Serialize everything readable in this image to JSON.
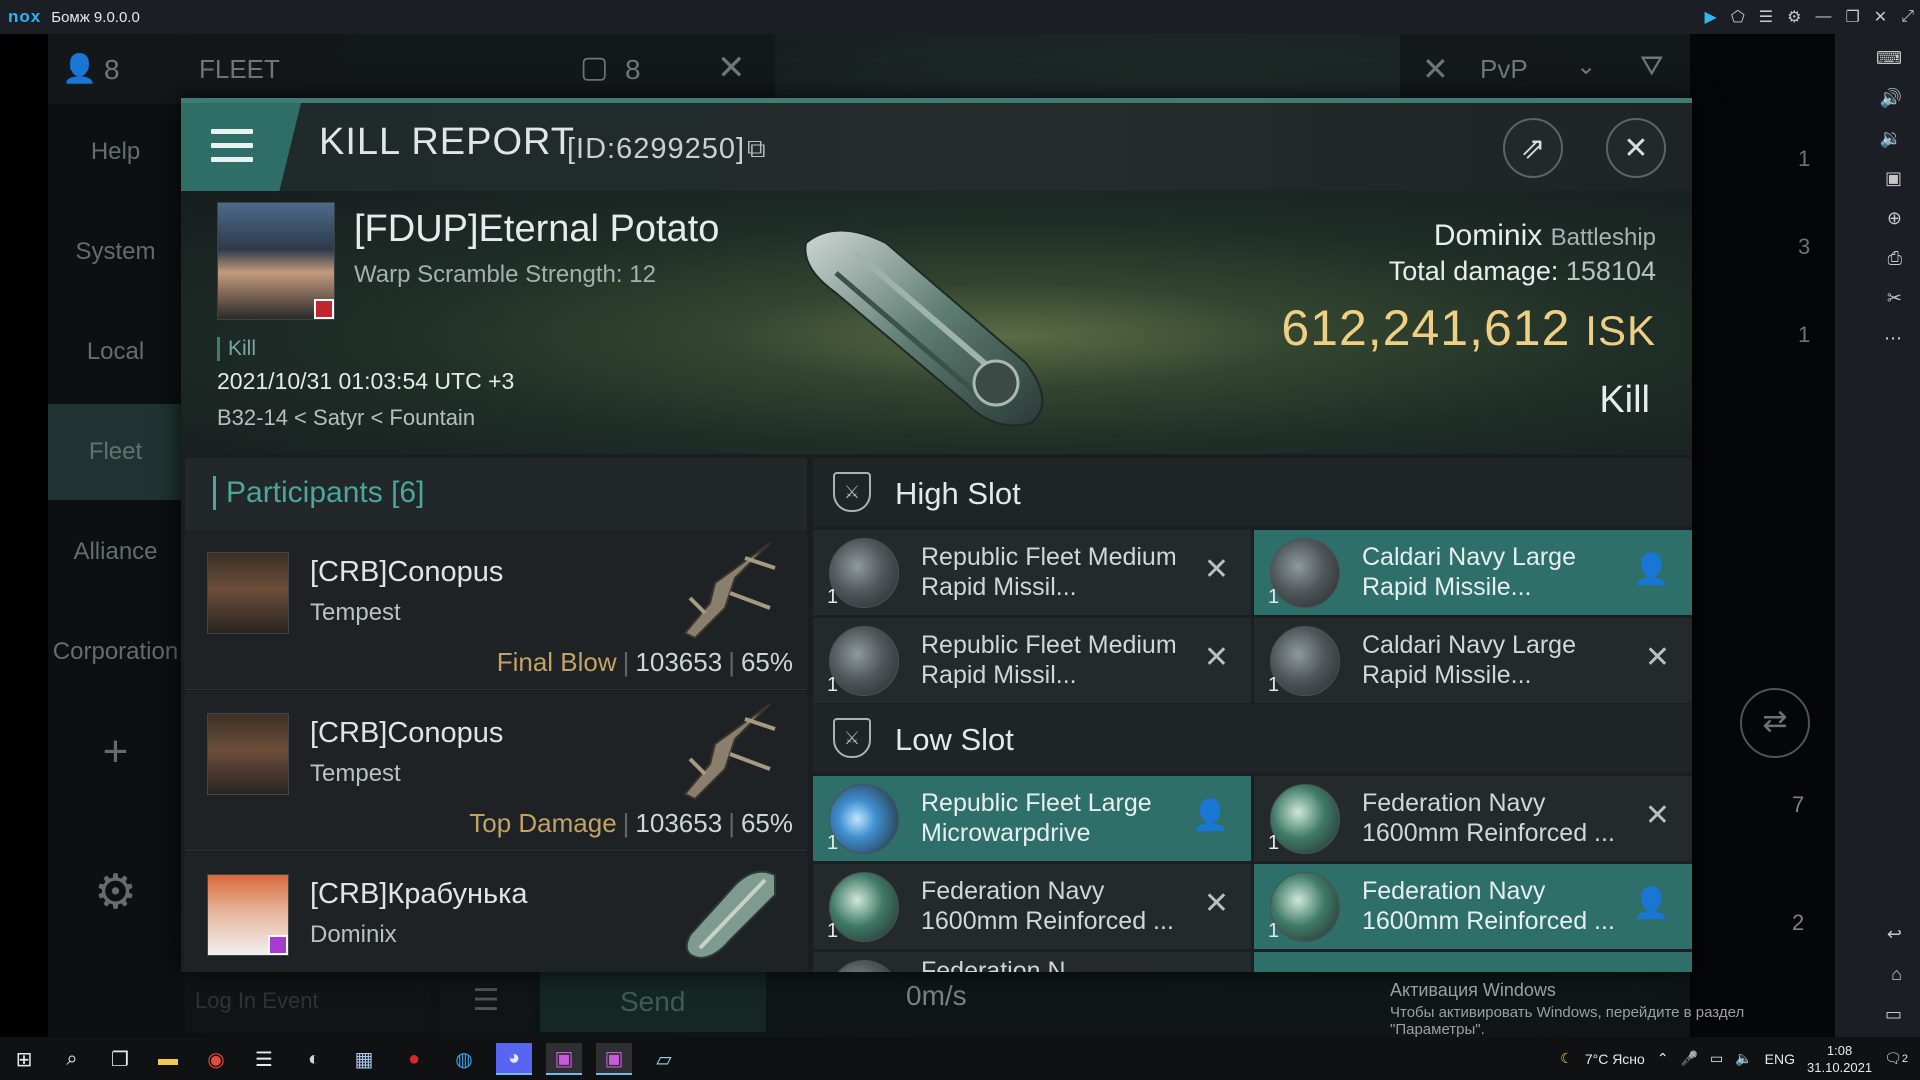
{
  "emulator": {
    "logo": "nox",
    "title": "Бомж 9.0.0.0",
    "controls": [
      "▶",
      "⬠",
      "☰",
      "⚙",
      "—",
      "❐",
      "✕",
      "⤢"
    ],
    "tools": [
      "⌨",
      "🔊",
      "🔉",
      "▣",
      "⊕",
      "⎙",
      "✂",
      "⋯",
      "↩",
      "⌂",
      "▭"
    ]
  },
  "game": {
    "topbar": {
      "fleet_count": "8",
      "fleet_label": "FLEET",
      "window_count": "8",
      "mode_label": "PvP"
    },
    "menu": [
      {
        "label": "Help"
      },
      {
        "label": "System"
      },
      {
        "label": "Local"
      },
      {
        "label": "Fleet",
        "active": true
      },
      {
        "label": "Alliance"
      },
      {
        "label": "Corporation"
      },
      {
        "label": "+"
      },
      {
        "label": "⚙"
      }
    ],
    "bottom": {
      "send_label": "Send",
      "speed": "0m/s",
      "log_placeholder": "Log In Event"
    },
    "right_counts": [
      "1",
      "3",
      "1",
      "7",
      "2"
    ]
  },
  "kill_report": {
    "title": "KILL REPORT",
    "report_id": "[ID:6299250]",
    "victim": {
      "name": "[FDUP]Eternal Potato",
      "warp_scram": "Warp Scramble Strength: 12",
      "tag": "Kill",
      "time": "2021/10/31 01:03:54 UTC +3",
      "location": "B32-14 < Satyr < Fountain",
      "ship": "Dominix",
      "ship_class": "Battleship",
      "total_damage_label": "Total damage:",
      "total_damage": "158104",
      "isk_value": "612,241,612",
      "isk_unit": "ISK",
      "result": "Kill"
    },
    "participants": {
      "title": "Participants",
      "count": "[6]",
      "items": [
        {
          "name": "[CRB]Conopus",
          "ship": "Tempest",
          "tag": "Final Blow",
          "damage": "103653",
          "percent": "65%"
        },
        {
          "name": "[CRB]Conopus",
          "ship": "Tempest",
          "tag": "Top Damage",
          "damage": "103653",
          "percent": "65%"
        },
        {
          "name": "[CRB]Крабунька",
          "ship": "Dominix",
          "tag": "",
          "damage": "",
          "percent": ""
        }
      ]
    },
    "fittings": {
      "high_slot_label": "High Slot",
      "low_slot_label": "Low Slot",
      "high": [
        {
          "name": "Republic Fleet Medium Rapid Missil...",
          "qty": "1",
          "state": "destroyed",
          "highlight": false
        },
        {
          "name": "Caldari Navy Large Rapid Missile...",
          "qty": "1",
          "state": "dropped",
          "highlight": true
        },
        {
          "name": "Republic Fleet Medium Rapid Missil...",
          "qty": "1",
          "state": "destroyed",
          "highlight": false
        },
        {
          "name": "Caldari Navy Large Rapid Missile...",
          "qty": "1",
          "state": "destroyed",
          "highlight": false
        }
      ],
      "low": [
        {
          "name": "Republic Fleet Large Microwarpdrive",
          "qty": "1",
          "state": "dropped",
          "highlight": true
        },
        {
          "name": "Federation Navy 1600mm Reinforced ...",
          "qty": "1",
          "state": "destroyed",
          "highlight": false
        },
        {
          "name": "Federation Navy 1600mm Reinforced ...",
          "qty": "1",
          "state": "destroyed",
          "highlight": false
        },
        {
          "name": "Federation Navy 1600mm Reinforced ...",
          "qty": "1",
          "state": "dropped",
          "highlight": true
        }
      ],
      "partial_label": "Federation N..."
    }
  },
  "watermark": {
    "line1": "Активация Windows",
    "line2": "Чтобы активировать Windows, перейдите в раздел \"Параметры\"."
  },
  "taskbar": {
    "weather": "7°C Ясно",
    "language": "ENG",
    "time": "1:08",
    "date": "31.10.2021",
    "notifications": "2"
  },
  "colors": {
    "accent": "#3e7c74",
    "isk": "#efcf84",
    "highlight": "#2f6f69",
    "tag": "#c3a266"
  }
}
